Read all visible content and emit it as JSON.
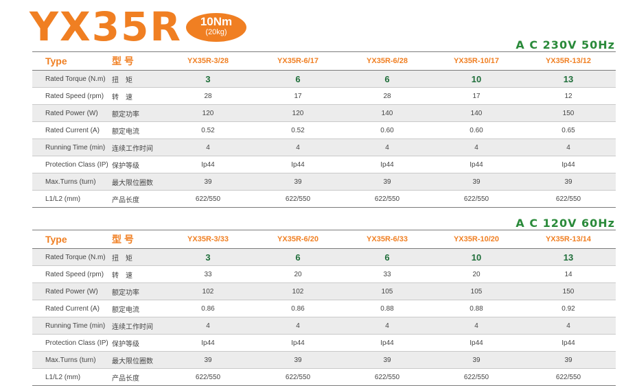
{
  "header": {
    "title": "YX35R",
    "badge_line1": "10Nm",
    "badge_line2": "(20kg)"
  },
  "labels": {
    "type_en": "Type",
    "type_cn": "型 号",
    "rows": [
      {
        "en": "Rated Torque (N.m)",
        "cn": "扭　矩"
      },
      {
        "en": "Rated Speed (rpm)",
        "cn": "转　速"
      },
      {
        "en": "Rated Power (W)",
        "cn": "额定功率"
      },
      {
        "en": "Rated Current (A)",
        "cn": "额定电流"
      },
      {
        "en": "Running Time (min)",
        "cn": "连续工作时间"
      },
      {
        "en": "Protection Class (IP)",
        "cn": "保护等级"
      },
      {
        "en": "Max.Turns (turn)",
        "cn": "最大限位圈数"
      },
      {
        "en": "L1/L2 (mm)",
        "cn": "产品长度"
      }
    ]
  },
  "tables": [
    {
      "voltage": "A C   230V 50Hz",
      "models": [
        "YX35R-3/28",
        "YX35R-6/17",
        "YX35R-6/28",
        "YX35R-10/17",
        "YX35R-13/12"
      ],
      "rows": [
        [
          "3",
          "6",
          "6",
          "10",
          "13"
        ],
        [
          "28",
          "17",
          "28",
          "17",
          "12"
        ],
        [
          "120",
          "120",
          "140",
          "140",
          "150"
        ],
        [
          "0.52",
          "0.52",
          "0.60",
          "0.60",
          "0.65"
        ],
        [
          "4",
          "4",
          "4",
          "4",
          "4"
        ],
        [
          "Ip44",
          "Ip44",
          "Ip44",
          "Ip44",
          "Ip44"
        ],
        [
          "39",
          "39",
          "39",
          "39",
          "39"
        ],
        [
          "622/550",
          "622/550",
          "622/550",
          "622/550",
          "622/550"
        ]
      ]
    },
    {
      "voltage": "A C   120V 60Hz",
      "models": [
        "YX35R-3/33",
        "YX35R-6/20",
        "YX35R-6/33",
        "YX35R-10/20",
        "YX35R-13/14"
      ],
      "rows": [
        [
          "3",
          "6",
          "6",
          "10",
          "13"
        ],
        [
          "33",
          "20",
          "33",
          "20",
          "14"
        ],
        [
          "102",
          "102",
          "105",
          "105",
          "150"
        ],
        [
          "0.86",
          "0.86",
          "0.88",
          "0.88",
          "0.92"
        ],
        [
          "4",
          "4",
          "4",
          "4",
          "4"
        ],
        [
          "Ip44",
          "Ip44",
          "Ip44",
          "Ip44",
          "Ip44"
        ],
        [
          "39",
          "39",
          "39",
          "39",
          "39"
        ],
        [
          "622/550",
          "622/550",
          "622/550",
          "622/550",
          "622/550"
        ]
      ]
    }
  ],
  "colors": {
    "accent_orange": "#f07f22",
    "voltage_green": "#2a8a3a",
    "torque_green": "#1f6e3a",
    "row_shade": "#ececec"
  }
}
